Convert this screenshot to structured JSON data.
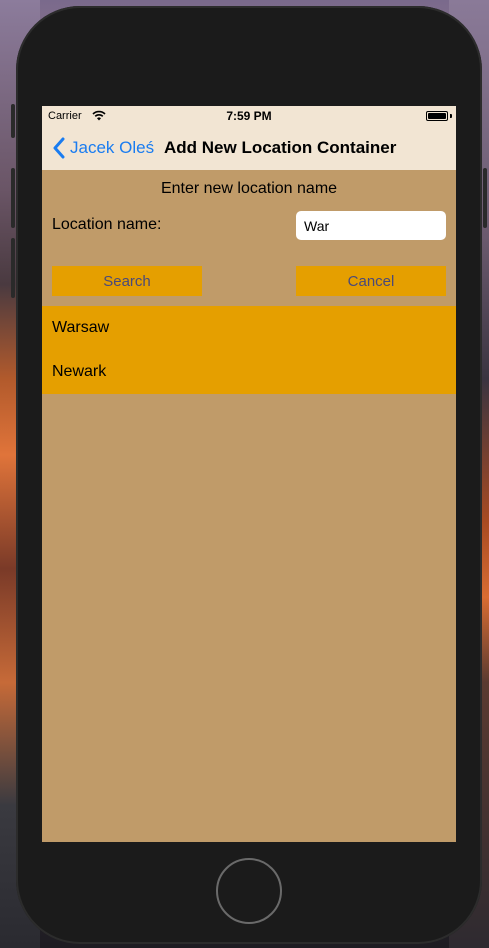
{
  "status_bar": {
    "carrier": "Carrier",
    "time": "7:59 PM"
  },
  "nav": {
    "back_label": "Jacek Oleś",
    "title": "Add New Location Container"
  },
  "form": {
    "prompt": "Enter new location name",
    "location_label": "Location name:",
    "location_value": "War",
    "search_label": "Search",
    "cancel_label": "Cancel"
  },
  "results": [
    {
      "label": "Warsaw"
    },
    {
      "label": "Newark"
    }
  ],
  "colors": {
    "accent": "#1a7cf0",
    "button_bg": "#e59f00",
    "screen_bg": "#c09b69",
    "nav_bg": "#f2e5d3"
  }
}
